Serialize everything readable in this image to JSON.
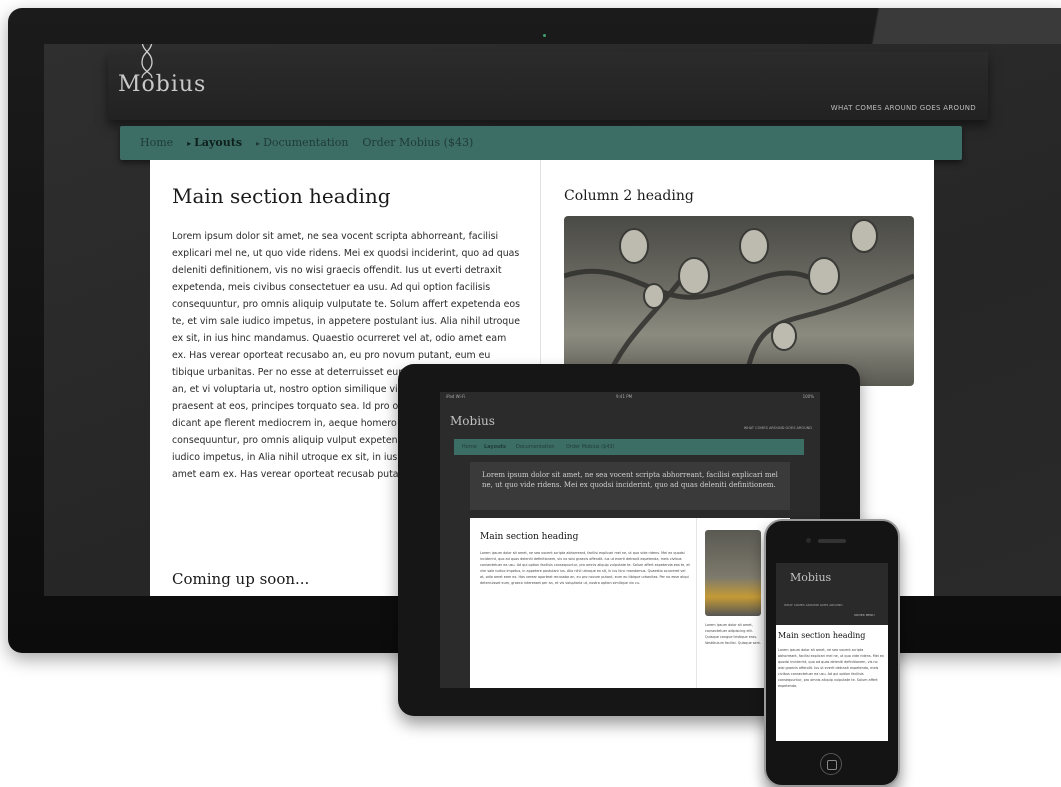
{
  "desktop": {
    "logo": "Mobius",
    "tagline": "WHAT COMES AROUND GOES AROUND",
    "nav": [
      {
        "label": "Home",
        "active": false,
        "caret": false
      },
      {
        "label": "Layouts",
        "active": true,
        "caret": true
      },
      {
        "label": "Documentation",
        "active": false,
        "caret": true
      },
      {
        "label": "Order Mobius ($43)",
        "active": false,
        "caret": false
      }
    ],
    "main_heading": "Main section heading",
    "main_text": "Lorem ipsum dolor sit amet, ne sea vocent scripta abhorreant, facilisi explicari mel ne, ut quo vide ridens. Mei ex quodsi inciderint, quo ad quas deleniti definitionem, vis no wisi graecis offendit. Ius ut everti detraxit expetenda, meis civibus consectetuer ea usu. Ad qui option facilisis consequuntur, pro omnis aliquip vulputate te. Solum affert expetenda eos te, et vim sale iudico impetus, in appetere postulant ius. Alia nihil utroque ex sit, in ius hinc mandamus. Quaestio ocurreret vel at, odio amet eam ex. Has verear oporteat recusabo an, eu pro novum putant, eum eu tibique urbanitas. Per no esse at deterruisset eum, graeco interesset per an, et vi voluptaria ut, nostro option similique vix cu, ero ius. Graecis praesent at eos, principes torquato sea. Id pro omnis constituam, ex sea dicant ape flerent mediocrem in, aeque homero similique facilisis consequuntur, pro omnis aliquip vulput expetenda eos te, et vim sale iudico impetus, in Alia nihil utroque ex sit, in ius hinc mandamus. odio amet eam ex. Has verear oporteat recusab putant.",
    "coming_heading": "Coming up soon...",
    "col2_heading": "Column 2 heading"
  },
  "tablet": {
    "status_left": "iPad  Wi-Fi",
    "status_time": "9:41 PM",
    "status_right": "100%",
    "logo": "Mobius",
    "tagline": "WHAT COMES AROUND GOES AROUND",
    "nav": [
      "Home",
      "Layouts",
      "Documentation",
      "Order Mobius ($43)"
    ],
    "banner_text": "Lorem ipsum dolor sit amet, ne sea vocent scripta abhorreant, facilisi explicari mel ne, ut quo vide ridens. Mei ex quodsi inciderint, quo ad quas deleniti definitionem.",
    "main_heading": "Main section heading",
    "main_text": "Lorem ipsum dolor sit amet, ne sea vocent scripta abhorreant, facilisi explicari mel ne, ut quo vide ridens. Mei ex quodsi inciderint, quo ad quas deleniti definitionem, vis no wisi graecis offendit. Ius ut everti detraxit expetenda, meis civibus consectetuer ea usu. Ad qui option facilisis consequuntur, pro omnis aliquip vulputate te. Solum affert expetenda eos te, et vim sale iudico impetus, in appetere postulant ius. Alia nihil utroque ex sit, in ius hinc mandamus. Quaestio ocurreret vel at, odio amet eam ex. Has verear oporteat recusabo an, eu pro novum putant, eum eu tibique urbanitas. Per no esse atqui deterruisset eum, graeco interesset per an, et vis voluptaria ut, nostro option similique vix cu.",
    "col2_text": "Lorem ipsum dolor sit amet, consectetuer adipiscing elit. Quisque congue tristique eros. Vestibulum facilisi. Quisque sem."
  },
  "phone": {
    "logo": "Mobius",
    "tagline": "WHAT COMES AROUND GOES AROUND",
    "order_label": "ORDER MENU",
    "main_heading": "Main section heading",
    "main_text": "Lorem ipsum dolor sit amet, ne sea vocent scripta abhorreant, facilisi explicari mel ne, ut quo vide ridens. Mei ex quodsi inciderint, quo ad quas deleniti definitionem, vis no wisi graecis offendit. Ius ut everti detraxit expetenda, meis civibus consectetuer ea usu. Ad qui option facilisis consequuntur, pro omnis aliquip vulputate te. Solum affert expetenda."
  },
  "colors": {
    "nav_teal": "#3d6e66",
    "dark_bg": "#2a2a2a",
    "bezel": "#141414"
  }
}
